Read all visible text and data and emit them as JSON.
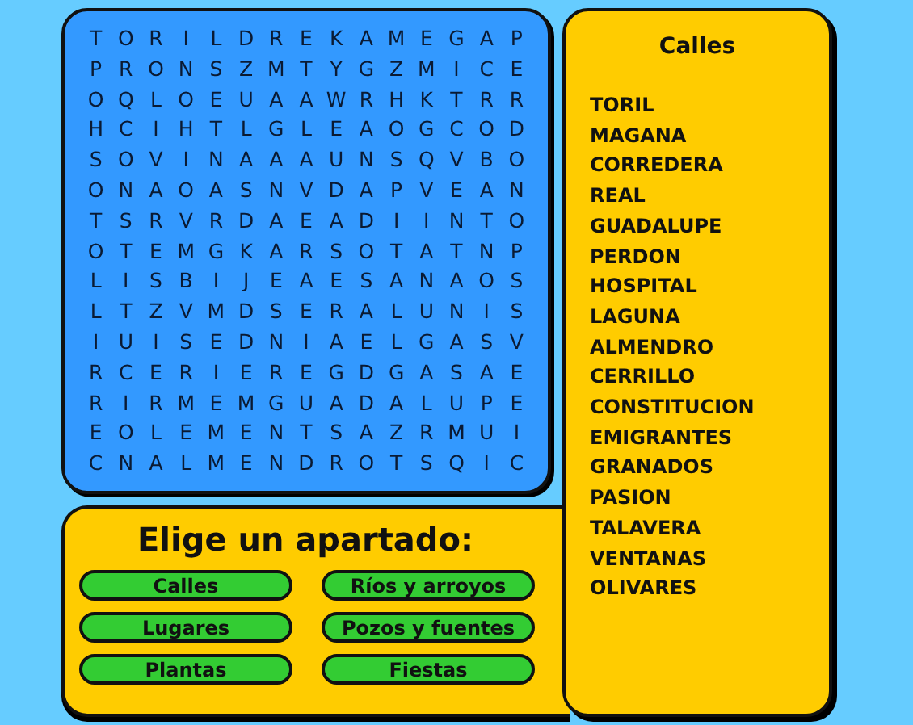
{
  "grid": [
    [
      "T",
      "O",
      "R",
      "I",
      "L",
      "D",
      "R",
      "E",
      "K",
      "A",
      "M",
      "E",
      "G",
      "A",
      "P"
    ],
    [
      "P",
      "R",
      "O",
      "N",
      "S",
      "Z",
      "M",
      "T",
      "Y",
      "G",
      "Z",
      "M",
      "I",
      "C",
      "E"
    ],
    [
      "O",
      "Q",
      "L",
      "O",
      "E",
      "U",
      "A",
      "A",
      "W",
      "R",
      "H",
      "K",
      "T",
      "R",
      "R"
    ],
    [
      "H",
      "C",
      "I",
      "H",
      "T",
      "L",
      "G",
      "L",
      "E",
      "A",
      "O",
      "G",
      "C",
      "O",
      "D"
    ],
    [
      "S",
      "O",
      "V",
      "I",
      "N",
      "A",
      "A",
      "A",
      "U",
      "N",
      "S",
      "Q",
      "V",
      "B",
      "O"
    ],
    [
      "O",
      "N",
      "A",
      "O",
      "A",
      "S",
      "N",
      "V",
      "D",
      "A",
      "P",
      "V",
      "E",
      "A",
      "N"
    ],
    [
      "T",
      "S",
      "R",
      "V",
      "R",
      "D",
      "A",
      "E",
      "A",
      "D",
      "I",
      "I",
      "N",
      "T",
      "O"
    ],
    [
      "O",
      "T",
      "E",
      "M",
      "G",
      "K",
      "A",
      "R",
      "S",
      "O",
      "T",
      "A",
      "T",
      "N",
      "P"
    ],
    [
      "L",
      "I",
      "S",
      "B",
      "I",
      "J",
      "E",
      "A",
      "E",
      "S",
      "A",
      "N",
      "A",
      "O",
      "S"
    ],
    [
      "L",
      "T",
      "Z",
      "V",
      "M",
      "D",
      "S",
      "E",
      "R",
      "A",
      "L",
      "U",
      "N",
      "I",
      "S"
    ],
    [
      "I",
      "U",
      "I",
      "S",
      "E",
      "D",
      "N",
      "I",
      "A",
      "E",
      "L",
      "G",
      "A",
      "S",
      "V"
    ],
    [
      "R",
      "C",
      "E",
      "R",
      "I",
      "E",
      "R",
      "E",
      "G",
      "D",
      "G",
      "A",
      "S",
      "A",
      "E"
    ],
    [
      "R",
      "I",
      "R",
      "M",
      "E",
      "M",
      "G",
      "U",
      "A",
      "D",
      "A",
      "L",
      "U",
      "P",
      "E"
    ],
    [
      "E",
      "O",
      "L",
      "E",
      "M",
      "E",
      "N",
      "T",
      "S",
      "A",
      "Z",
      "R",
      "M",
      "U",
      "I"
    ],
    [
      "C",
      "N",
      "A",
      "L",
      "M",
      "E",
      "N",
      "D",
      "R",
      "O",
      "T",
      "S",
      "Q",
      "I",
      "C"
    ]
  ],
  "word_list": {
    "title": "Calles",
    "words": [
      "TORIL",
      "MAGANA",
      "CORREDERA",
      "REAL",
      "GUADALUPE",
      "PERDON",
      "HOSPITAL",
      "LAGUNA",
      "ALMENDRO",
      "CERRILLO",
      "CONSTITUCION",
      "EMIGRANTES",
      "GRANADOS",
      "PASION",
      "TALAVERA",
      "VENTANAS",
      "OLIVARES"
    ]
  },
  "chooser": {
    "title": "Elige un apartado:",
    "buttons": [
      "Calles",
      "Ríos y arroyos",
      "Lugares",
      "Pozos y fuentes",
      "Plantas",
      "Fiestas"
    ]
  }
}
